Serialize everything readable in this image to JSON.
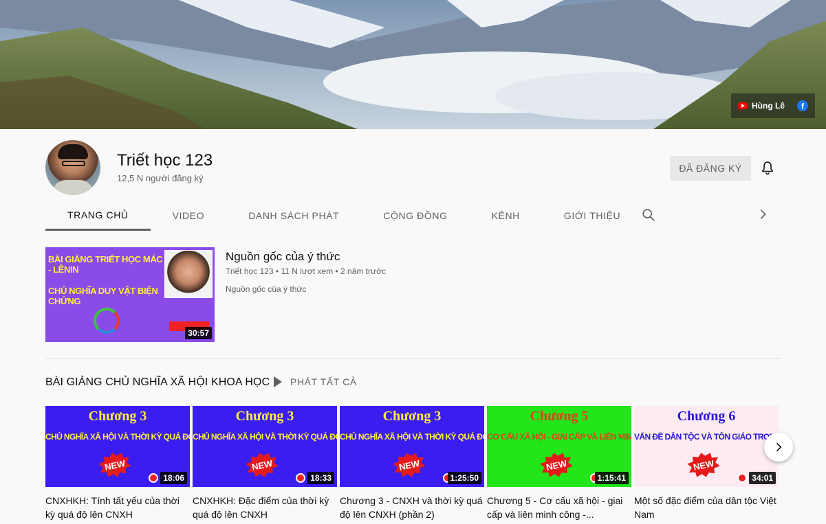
{
  "banner": {
    "links": {
      "youtube_label": "Hùng Lê"
    }
  },
  "channel": {
    "name": "Triết học 123",
    "subscribers": "12,5 N người đăng ký",
    "subscribed_label": "ĐÃ ĐĂNG KÝ"
  },
  "tabs": [
    {
      "label": "TRANG CHỦ",
      "active": true
    },
    {
      "label": "VIDEO"
    },
    {
      "label": "DANH SÁCH PHÁT"
    },
    {
      "label": "CỘNG ĐỒNG"
    },
    {
      "label": "KÊNH"
    },
    {
      "label": "GIỚI THIỆU"
    }
  ],
  "featured": {
    "thumb_line1": "BÀI GIẢNG TRIẾT HỌC MÁC - LÊNIN",
    "thumb_line2": "CHỦ NGHĨA DUY VẬT BIỆN CHỨNG",
    "duration": "30:57",
    "title": "Nguồn gốc của ý thức",
    "meta": "Triết học 123 • 11 N lượt xem • 2 năm trước",
    "description": "Nguồn gốc của ý thức"
  },
  "shelf": {
    "title": "BÀI GIẢNG CHỦ NGHĨA XÃ HỘI KHOA HỌC",
    "play_all": "PHÁT TẤT CẢ",
    "videos": [
      {
        "thumb_heading": "Chương 3",
        "thumb_sub": "CHỦ NGHĨA XÃ HỘI VÀ THỜI KỲ QUÁ ĐỘ LÊN CNXH",
        "badge": "NEW",
        "duration": "18:06",
        "title": "CNXHKH: Tính tất yếu của thời kỳ quá độ lên CNXH",
        "bg": "#3a1df0",
        "fg": "#ffef3a"
      },
      {
        "thumb_heading": "Chương 3",
        "thumb_sub": "CHỦ NGHĨA XÃ HỘI VÀ THỜI KỲ QUÁ ĐỘ LÊN CNXH",
        "badge": "NEW",
        "duration": "18:33",
        "title": "CNXHKH: Đặc điểm của thời kỳ quá độ lên CNXH",
        "bg": "#3a1df0",
        "fg": "#ffef3a"
      },
      {
        "thumb_heading": "Chương 3",
        "thumb_sub": "CHỦ NGHĨA XÃ HỘI VÀ THỜI KỲ QUÁ ĐỘ LÊN CNXH",
        "badge": "NEW",
        "duration": "1:25:50",
        "title": "Chương 3 - CNXH và thời kỳ quá độ lên CNXH (phần 2)",
        "bg": "#3a1df0",
        "fg": "#ffef3a"
      },
      {
        "thumb_heading": "Chương 5",
        "thumb_sub": "CƠ CẤU XÃ HỘI - GIAI CẤP VÀ LIÊN MINH TRONG THỜI KỲ QUÁ ĐỘ",
        "badge": "NEW",
        "duration": "1:15:41",
        "title": "Chương 5 - Cơ cấu xã hội - giai cấp và liên minh công -...",
        "bg": "#22e51a",
        "fg": "#e0431a"
      },
      {
        "thumb_heading": "Chương 6",
        "thumb_sub": "VẤN ĐỀ DÂN TỘC VÀ TÔN GIÁO TRONG THỜI KỲ QUÁ ĐỘ",
        "badge": "NEW",
        "duration": "34:01",
        "title": "Một số đặc điểm của dân tộc Việt Nam",
        "bg": "#fdebf3",
        "fg": "#2a17d8"
      }
    ]
  }
}
